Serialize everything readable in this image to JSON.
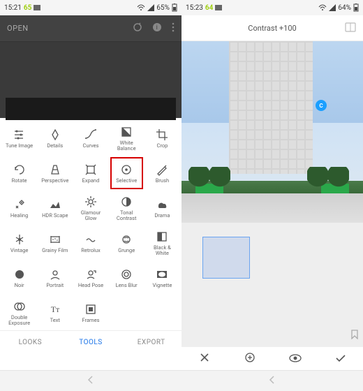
{
  "left": {
    "status": {
      "time": "15:21",
      "step": "65",
      "battery": "65%"
    },
    "topbar": {
      "open": "OPEN"
    },
    "tools": [
      {
        "name": "tune-image",
        "label": "Tune Image"
      },
      {
        "name": "details",
        "label": "Details"
      },
      {
        "name": "curves",
        "label": "Curves"
      },
      {
        "name": "white-balance",
        "label": "White\nBalance"
      },
      {
        "name": "crop",
        "label": "Crop"
      },
      {
        "name": "rotate",
        "label": "Rotate"
      },
      {
        "name": "perspective",
        "label": "Perspective"
      },
      {
        "name": "expand",
        "label": "Expand"
      },
      {
        "name": "selective",
        "label": "Selective",
        "highlight": true
      },
      {
        "name": "brush",
        "label": "Brush"
      },
      {
        "name": "healing",
        "label": "Healing"
      },
      {
        "name": "hdr-scape",
        "label": "HDR Scape"
      },
      {
        "name": "glamour-glow",
        "label": "Glamour\nGlow"
      },
      {
        "name": "tonal-contrast",
        "label": "Tonal\nContrast"
      },
      {
        "name": "drama",
        "label": "Drama"
      },
      {
        "name": "vintage",
        "label": "Vintage"
      },
      {
        "name": "grainy-film",
        "label": "Grainy Film"
      },
      {
        "name": "retrolux",
        "label": "Retrolux"
      },
      {
        "name": "grunge",
        "label": "Grunge"
      },
      {
        "name": "black-white",
        "label": "Black &\nWhite"
      },
      {
        "name": "noir",
        "label": "Noir"
      },
      {
        "name": "portrait",
        "label": "Portrait"
      },
      {
        "name": "head-pose",
        "label": "Head Pose"
      },
      {
        "name": "lens-blur",
        "label": "Lens Blur"
      },
      {
        "name": "vignette",
        "label": "Vignette"
      },
      {
        "name": "double-exposure",
        "label": "Double\nExposure"
      },
      {
        "name": "text",
        "label": "Text"
      },
      {
        "name": "frames",
        "label": "Frames"
      }
    ],
    "tabs": {
      "looks": "LOOKS",
      "tools": "TOOLS",
      "export": "EXPORT",
      "active": "tools"
    }
  },
  "right": {
    "status": {
      "time": "15:23",
      "step": "64",
      "battery": "64%"
    },
    "header": {
      "title": "Contrast +100"
    },
    "point_label": "C",
    "actions": {
      "cancel": "✕",
      "add": "+",
      "preview": "eye",
      "apply": "✓"
    }
  }
}
